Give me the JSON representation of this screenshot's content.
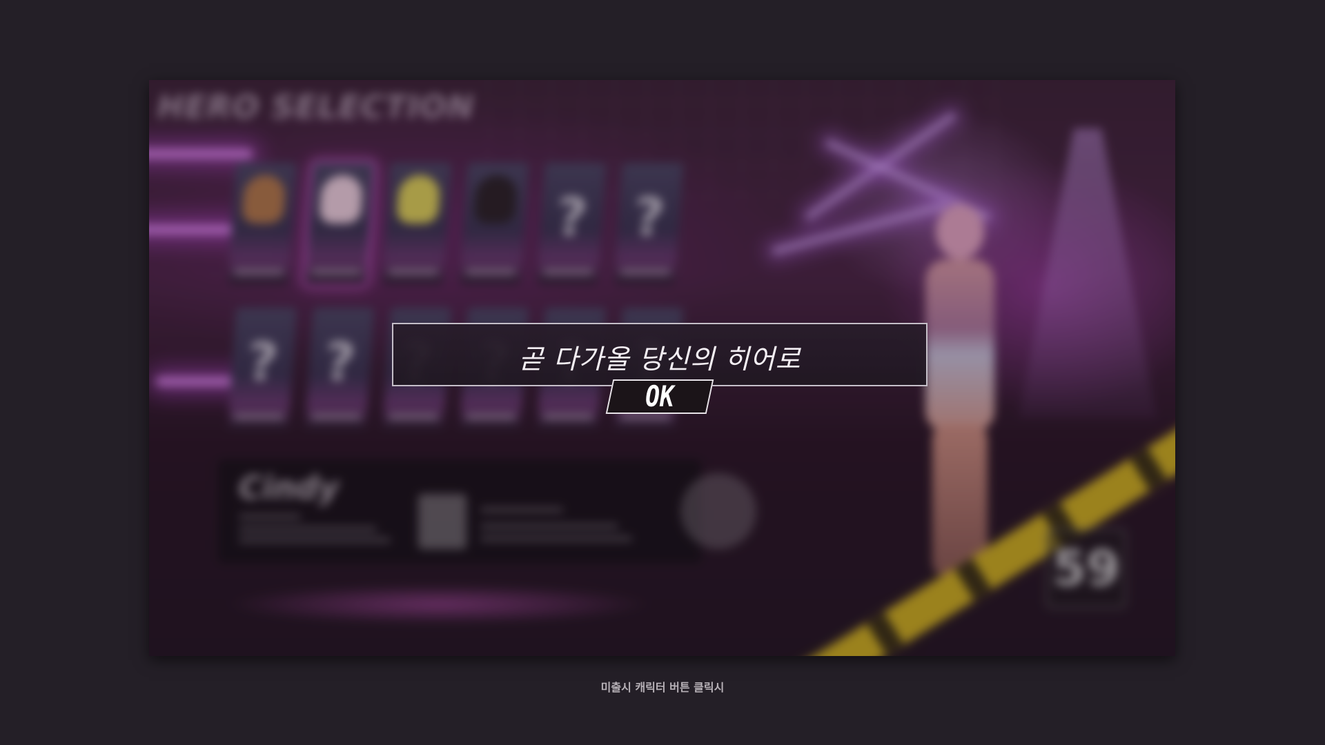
{
  "background_scene": {
    "title": "HERO SELECTION",
    "hero_cards_row1": [
      {
        "type": "portrait",
        "tone": "#b57a4c"
      },
      {
        "type": "portrait",
        "tone": "#f1d3e2",
        "selected": true
      },
      {
        "type": "portrait",
        "tone": "#e0d35a"
      },
      {
        "type": "portrait",
        "tone": "#2b2228"
      },
      {
        "type": "locked",
        "label": "?"
      },
      {
        "type": "locked",
        "label": "?"
      }
    ],
    "hero_cards_row2": [
      {
        "type": "locked",
        "label": "?"
      },
      {
        "type": "locked",
        "label": "?"
      },
      {
        "type": "locked",
        "label": "?"
      },
      {
        "type": "locked",
        "label": "?"
      },
      {
        "type": "locked",
        "label": "?"
      },
      {
        "type": "locked",
        "label": "?"
      }
    ],
    "selected_hero_name": "Cindy",
    "timer": "59",
    "colors": {
      "accent_purple": "#c85ad2",
      "tape_yellow": "#cfb021"
    }
  },
  "modal": {
    "message": "곧 다가올 당신의 히어로",
    "ok_label": "OK"
  },
  "caption": "미출시 캐릭터 버튼 클릭시"
}
